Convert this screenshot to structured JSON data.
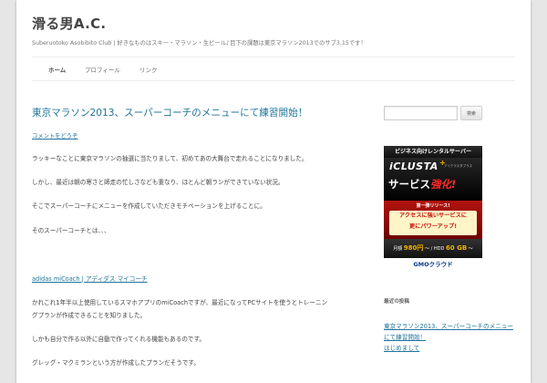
{
  "site": {
    "title": "滑る男A.C.",
    "description": "Suberuotoko Asobibito Club | 好きなものはスキー・マラソン・生ビール♪目下の課題は東京マラソン2013でのサブ3.15です！"
  },
  "nav": {
    "items": [
      {
        "label": "ホーム",
        "current": true
      },
      {
        "label": "プロフィール"
      },
      {
        "label": "リンク"
      }
    ]
  },
  "post": {
    "title": "東京マラソン2013、スーパーコーチのメニューにて練習開始！",
    "comment_link": "コメントをどうぞ",
    "paragraphs": [
      "ラッキーなことに東京マラソンの抽選に当たりまして、初めてあの大舞台で走れることになりました。",
      "しかし、最近は朝の寒さと師走の忙しさなども重なり、ほとんど朝ランができていない状況。",
      "そこでスーパーコーチにメニューを作成していただきモチベーションを上げることに。",
      "そのスーパーコーチとは、、、"
    ],
    "link_text": "adidas miCoach | アディダス マイコーチ",
    "paragraph_after_link_1": "かれこれ1年半以上使用しているスマホアプリのmiCoachですが、最近になってPCサイトを使うとトレーニン",
    "paragraph_after_link_2": "グプランが作成できることを知りました。",
    "paragraph_3": "しかも自分で作る以外に自動で作ってくれる機能もあるのです。",
    "paragraph_4": "グレッグ・マクミランという方が作成したプランだそうです。"
  },
  "sidebar": {
    "search": {
      "placeholder": "",
      "button_label": "検索"
    },
    "ad": {
      "top": "ビジネス向けレンタルサーバー",
      "brand": "iCLUSTA",
      "brand_sub": "アイクラスタプラス",
      "service": "サービス",
      "kyoka": "強化!",
      "release": "第一弾リリース!",
      "line1": "アクセスに強いサービスに",
      "line2": "更にパワーアップ!",
      "price_prefix": "月額",
      "price": "980円",
      "price_mid": "〜 / HDD",
      "hdd": "60 GB",
      "price_suffix": "〜",
      "logo": "GMOクラウド"
    },
    "recent_title": "最近の投稿",
    "recent_posts": [
      "東京マラソン2013、スーパーコーチのメニュー",
      "にて練習開始！",
      "はじめまして"
    ]
  }
}
